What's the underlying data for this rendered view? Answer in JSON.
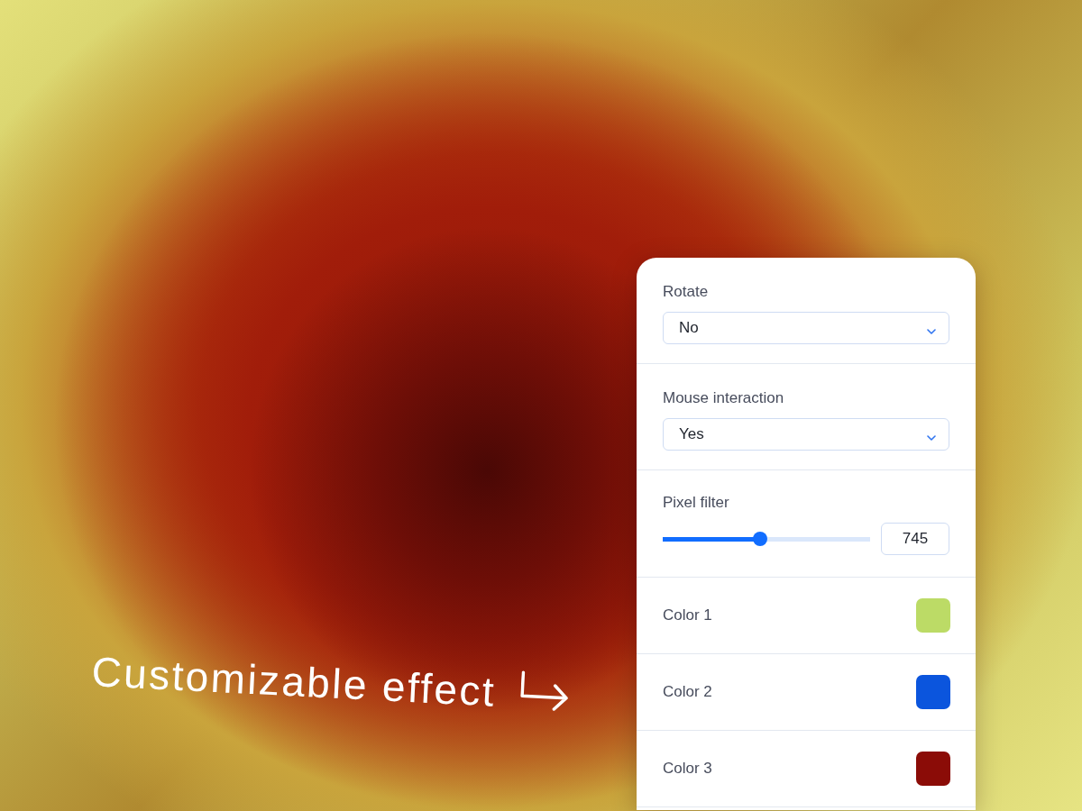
{
  "caption": {
    "text": "Customizable effect"
  },
  "settings_panel": {
    "settings": [
      {
        "kind": "dropdown",
        "label": "Rotate",
        "value": "No"
      },
      {
        "kind": "dropdown",
        "label": "Mouse interaction",
        "value": "Yes"
      },
      {
        "kind": "slider",
        "label": "Pixel filter",
        "level": 0.47,
        "value": "745"
      },
      {
        "kind": "color",
        "label": "Color 1",
        "color": "#bcdb66"
      },
      {
        "kind": "color",
        "label": "Color 2",
        "color": "#0b55dd"
      },
      {
        "kind": "color",
        "label": "Color 3",
        "color": "#8b0c07"
      }
    ]
  }
}
